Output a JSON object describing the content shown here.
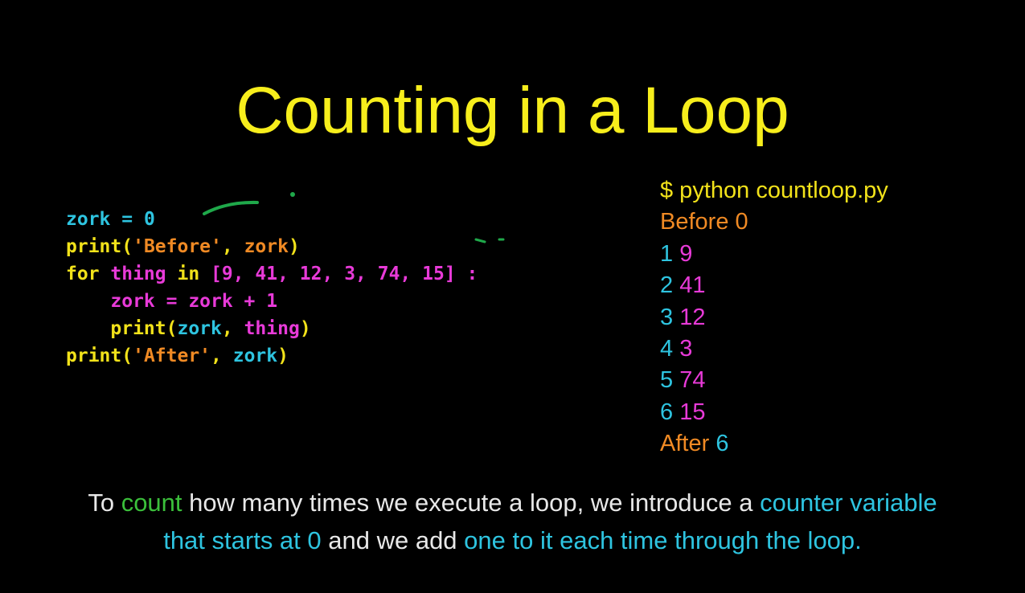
{
  "colors": {
    "background": "#000000",
    "title": "#f7ee1c",
    "variable": "#2ec4e0",
    "keyword": "#f2e21a",
    "string": "#f08a24",
    "magenta": "#e83ad8",
    "green": "#3bbf3b",
    "plain_text": "#e8e8e8",
    "annotation": "#1fa84a"
  },
  "title": "Counting in a Loop",
  "code": {
    "lines": [
      [
        {
          "text": "zork",
          "role": "variable"
        },
        {
          "text": " = ",
          "role": "variable"
        },
        {
          "text": "0",
          "role": "variable"
        }
      ],
      [
        {
          "text": "print(",
          "role": "keyword"
        },
        {
          "text": "'Before'",
          "role": "string"
        },
        {
          "text": ", ",
          "role": "keyword"
        },
        {
          "text": "zork",
          "role": "string"
        },
        {
          "text": ")",
          "role": "keyword"
        }
      ],
      [
        {
          "text": "for ",
          "role": "keyword"
        },
        {
          "text": "thing",
          "role": "magenta"
        },
        {
          "text": " in ",
          "role": "keyword"
        },
        {
          "text": "[9, 41, 12, 3, 74, 15]",
          "role": "magenta"
        },
        {
          "text": " :",
          "role": "magenta"
        }
      ],
      [
        {
          "text": "    ",
          "role": "variable"
        },
        {
          "text": "zork = zork + 1",
          "role": "magenta"
        }
      ],
      [
        {
          "text": "    ",
          "role": "variable"
        },
        {
          "text": "print(",
          "role": "keyword"
        },
        {
          "text": "zork",
          "role": "variable"
        },
        {
          "text": ", ",
          "role": "keyword"
        },
        {
          "text": "thing",
          "role": "magenta"
        },
        {
          "text": ")",
          "role": "keyword"
        }
      ],
      [
        {
          "text": "print(",
          "role": "keyword"
        },
        {
          "text": "'After'",
          "role": "string"
        },
        {
          "text": ", ",
          "role": "keyword"
        },
        {
          "text": "zork",
          "role": "variable"
        },
        {
          "text": ")",
          "role": "keyword"
        }
      ]
    ]
  },
  "output": {
    "lines": [
      [
        {
          "text": "$ python countloop.py",
          "role": "keyword"
        }
      ],
      [
        {
          "text": "Before 0",
          "role": "string"
        }
      ],
      [
        {
          "text": "1 ",
          "role": "variable"
        },
        {
          "text": "9",
          "role": "magenta"
        }
      ],
      [
        {
          "text": "2 ",
          "role": "variable"
        },
        {
          "text": "41",
          "role": "magenta"
        }
      ],
      [
        {
          "text": "3 ",
          "role": "variable"
        },
        {
          "text": "12",
          "role": "magenta"
        }
      ],
      [
        {
          "text": "4 ",
          "role": "variable"
        },
        {
          "text": "3",
          "role": "magenta"
        }
      ],
      [
        {
          "text": "5 ",
          "role": "variable"
        },
        {
          "text": "74",
          "role": "magenta"
        }
      ],
      [
        {
          "text": "6 ",
          "role": "variable"
        },
        {
          "text": "15",
          "role": "magenta"
        }
      ],
      [
        {
          "text": "After ",
          "role": "string"
        },
        {
          "text": "6",
          "role": "variable"
        }
      ]
    ]
  },
  "caption": {
    "rows": [
      [
        {
          "text": "To ",
          "role": "plain_text"
        },
        {
          "text": "count",
          "role": "green"
        },
        {
          "text": " how many times we execute a loop, we introduce a ",
          "role": "plain_text"
        },
        {
          "text": "counter variable",
          "role": "variable"
        }
      ],
      [
        {
          "text": "that starts at 0",
          "role": "variable"
        },
        {
          "text": " and we add ",
          "role": "plain_text"
        },
        {
          "text": "one to it each time through the loop.",
          "role": "variable"
        }
      ]
    ]
  }
}
